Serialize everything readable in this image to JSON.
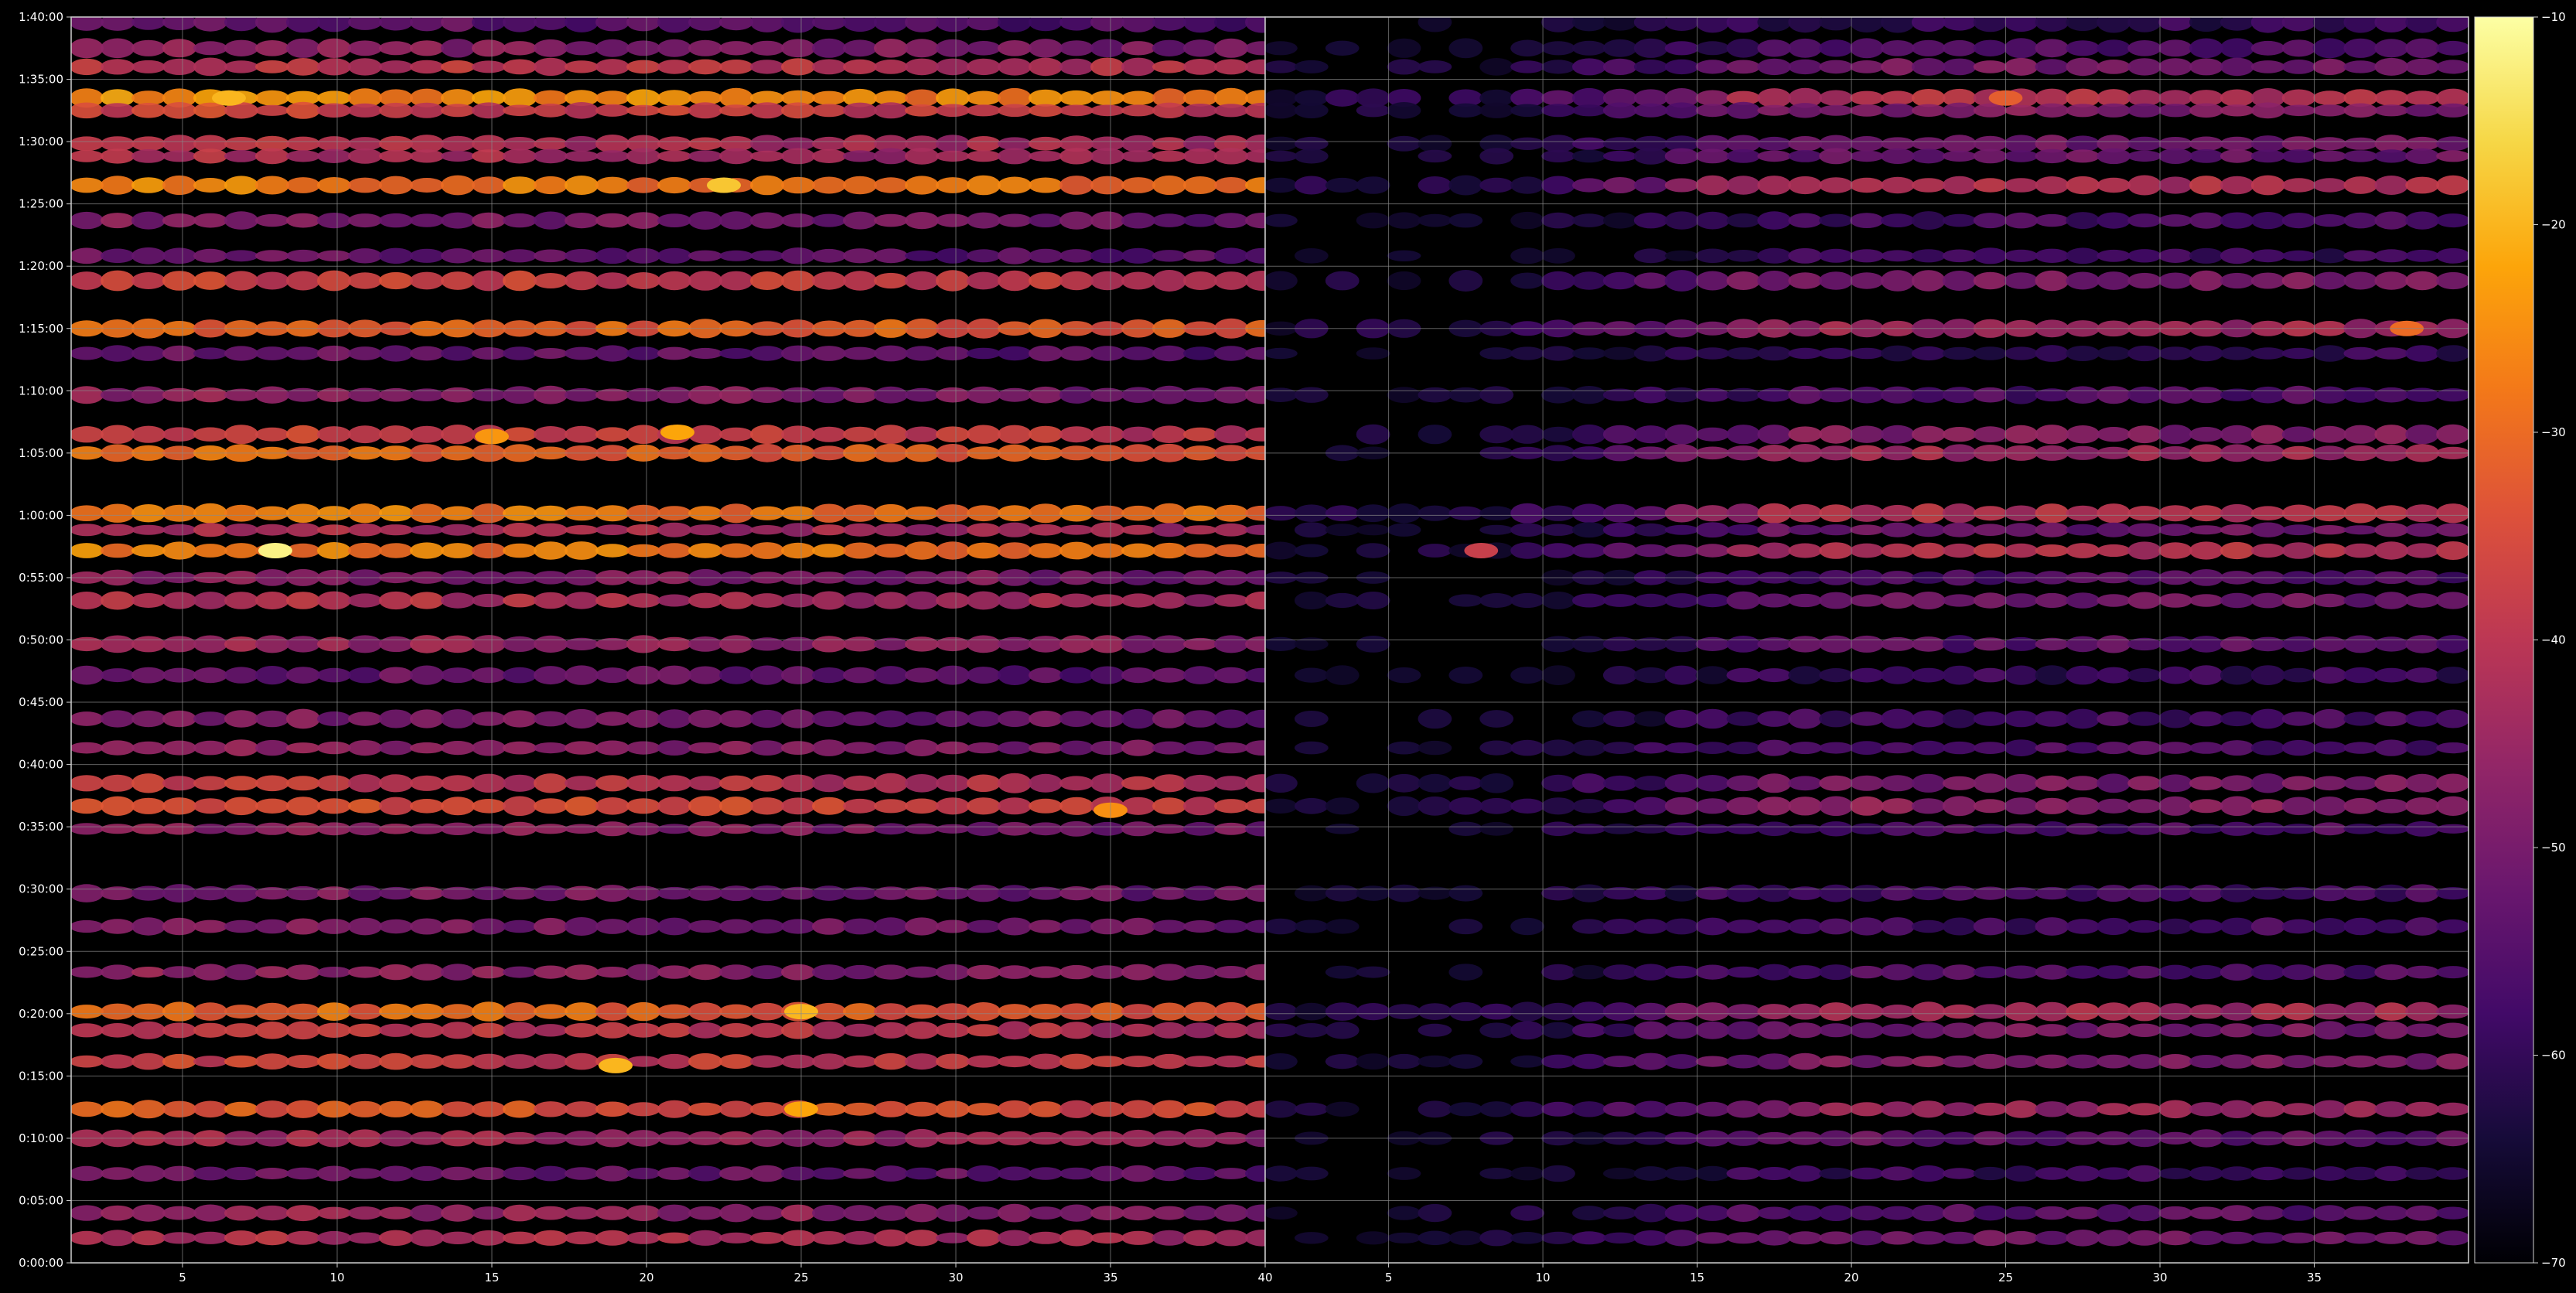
{
  "chart_data": {
    "type": "heatmap",
    "title": "",
    "colormap": "inferno",
    "background": "#000000",
    "grid": true,
    "grid_color": "#8a8a8a",
    "legend": "colorbar-right",
    "colorbar": {
      "min": -70,
      "max": -10,
      "ticks": [
        -10,
        -20,
        -30,
        -40,
        -50,
        -60,
        -70
      ],
      "tick_labels": [
        "−10",
        "−20",
        "−30",
        "−40",
        "−50",
        "−60",
        "−70"
      ]
    },
    "y_axis": {
      "range_seconds": [
        0,
        6000
      ],
      "ticks_seconds": [
        0,
        300,
        600,
        900,
        1200,
        1500,
        1800,
        2100,
        2400,
        2700,
        3000,
        3300,
        3600,
        3900,
        4200,
        4500,
        4800,
        5100,
        5400,
        5700
      ],
      "tick_labels": [
        "0:00:00",
        "0:05:00",
        "0:10:00",
        "0:15:00",
        "0:20:00",
        "0:25:00",
        "0:30:00",
        "0:35:00",
        "0:40:00",
        "0:45:00",
        "0:50:00",
        "0:55:00",
        "1:00:00",
        "1:05:00",
        "1:10:00",
        "1:15:00",
        "1:20:00",
        "1:25:00",
        "1:30:00",
        "1:35:00",
        "1:40:00"
      ]
    },
    "panels": [
      {
        "name": "left",
        "x_range": [
          1.4,
          40
        ],
        "x_ticks": [
          5,
          10,
          15,
          20,
          25,
          30,
          35,
          40
        ],
        "x_tick_labels": [
          "5",
          "10",
          "15",
          "20",
          "25",
          "30",
          "35",
          "40"
        ],
        "level_scale": 1.0
      },
      {
        "name": "right",
        "x_range": [
          1,
          40
        ],
        "x_ticks": [
          5,
          10,
          15,
          20,
          25,
          30,
          35,
          40
        ],
        "x_tick_labels": [
          "5",
          "10",
          "15",
          "20",
          "25",
          "30",
          "35"
        ],
        "level_scale": 0.72
      }
    ],
    "bands": [
      {
        "t": 5975,
        "level": -56,
        "width": 1.0
      },
      {
        "t": 5850,
        "level": -50,
        "width": 0.9
      },
      {
        "t": 5760,
        "level": -42,
        "width": 0.8
      },
      {
        "t": 5610,
        "level": -28,
        "width": 0.9
      },
      {
        "t": 5550,
        "level": -40,
        "width": 0.7
      },
      {
        "t": 5390,
        "level": -44,
        "width": 0.8
      },
      {
        "t": 5330,
        "level": -45,
        "width": 0.7
      },
      {
        "t": 5190,
        "level": -30,
        "width": 0.9
      },
      {
        "t": 5020,
        "level": -52,
        "width": 0.8
      },
      {
        "t": 4850,
        "level": -55,
        "width": 0.7
      },
      {
        "t": 4730,
        "level": -40,
        "width": 1.0
      },
      {
        "t": 4500,
        "level": -33,
        "width": 0.9
      },
      {
        "t": 4380,
        "level": -55,
        "width": 0.7
      },
      {
        "t": 4180,
        "level": -50,
        "width": 0.8
      },
      {
        "t": 3990,
        "level": -40,
        "width": 0.9
      },
      {
        "t": 3900,
        "level": -33,
        "width": 0.8
      },
      {
        "t": 3610,
        "level": -30,
        "width": 0.9
      },
      {
        "t": 3530,
        "level": -45,
        "width": 0.6
      },
      {
        "t": 3430,
        "level": -30,
        "width": 0.8
      },
      {
        "t": 3300,
        "level": -50,
        "width": 0.7
      },
      {
        "t": 3190,
        "level": -44,
        "width": 0.8
      },
      {
        "t": 2980,
        "level": -48,
        "width": 0.8
      },
      {
        "t": 2830,
        "level": -55,
        "width": 0.9
      },
      {
        "t": 2620,
        "level": -52,
        "width": 0.9
      },
      {
        "t": 2480,
        "level": -50,
        "width": 0.7
      },
      {
        "t": 2310,
        "level": -42,
        "width": 0.9
      },
      {
        "t": 2200,
        "level": -38,
        "width": 0.9
      },
      {
        "t": 2090,
        "level": -50,
        "width": 0.6
      },
      {
        "t": 1780,
        "level": -52,
        "width": 0.8
      },
      {
        "t": 1620,
        "level": -52,
        "width": 0.8
      },
      {
        "t": 1400,
        "level": -50,
        "width": 0.7
      },
      {
        "t": 1210,
        "level": -33,
        "width": 0.9
      },
      {
        "t": 1120,
        "level": -42,
        "width": 0.8
      },
      {
        "t": 970,
        "level": -40,
        "width": 0.7
      },
      {
        "t": 740,
        "level": -36,
        "width": 0.8
      },
      {
        "t": 600,
        "level": -46,
        "width": 0.8
      },
      {
        "t": 430,
        "level": -54,
        "width": 0.7
      },
      {
        "t": 240,
        "level": -48,
        "width": 0.8
      },
      {
        "t": 120,
        "level": -44,
        "width": 0.7
      }
    ],
    "hot_spots": [
      {
        "panel": "left",
        "x": 8,
        "t": 3430,
        "level": -12
      },
      {
        "panel": "left",
        "x": 19,
        "t": 950,
        "level": -20
      },
      {
        "panel": "left",
        "x": 22.5,
        "t": 5190,
        "level": -18
      },
      {
        "panel": "left",
        "x": 6.5,
        "t": 5610,
        "level": -20
      },
      {
        "panel": "left",
        "x": 25,
        "t": 1210,
        "level": -20
      },
      {
        "panel": "left",
        "x": 25,
        "t": 740,
        "level": -22
      },
      {
        "panel": "left",
        "x": 35,
        "t": 2180,
        "level": -25
      },
      {
        "panel": "left",
        "x": 21,
        "t": 4000,
        "level": -22
      },
      {
        "panel": "left",
        "x": 15,
        "t": 3980,
        "level": -24
      },
      {
        "panel": "right",
        "x": 8,
        "t": 3430,
        "level": -38
      },
      {
        "panel": "right",
        "x": 25,
        "t": 5610,
        "level": -32
      },
      {
        "panel": "right",
        "x": 38,
        "t": 4500,
        "level": -30
      }
    ]
  }
}
